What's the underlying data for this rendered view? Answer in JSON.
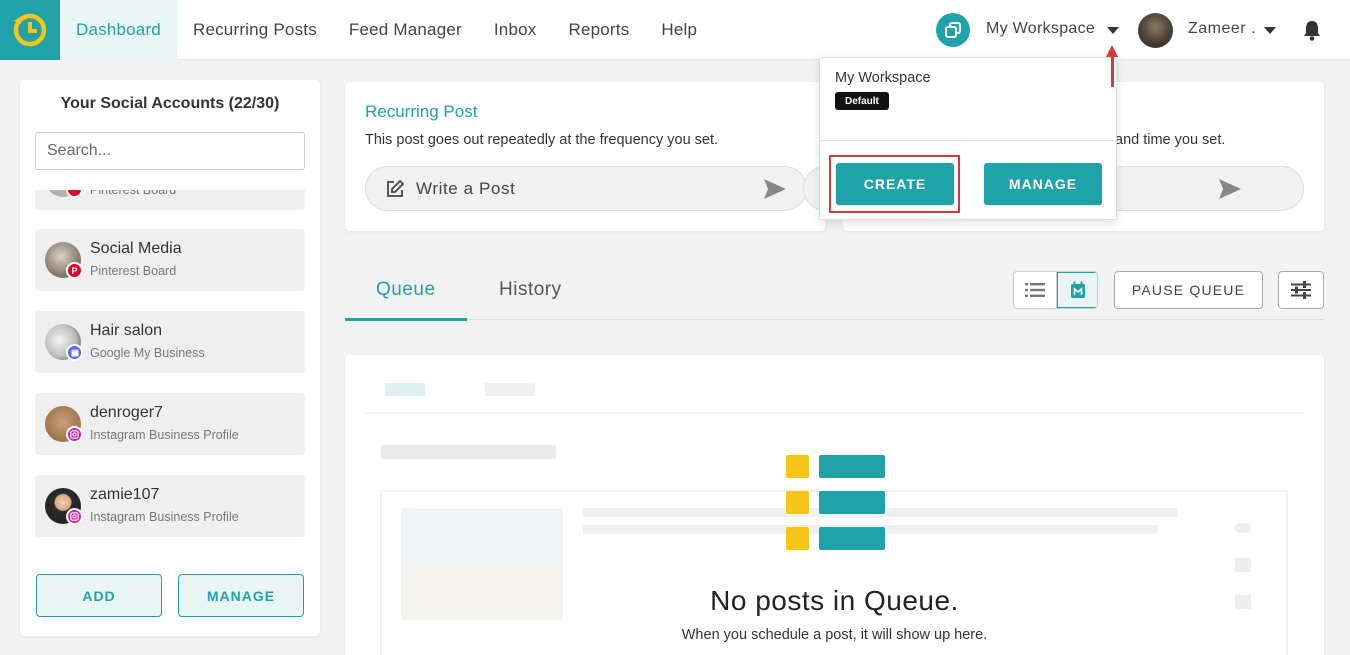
{
  "nav": {
    "items": [
      {
        "label": "Dashboard",
        "active": true
      },
      {
        "label": "Recurring Posts",
        "active": false
      },
      {
        "label": "Feed Manager",
        "active": false
      },
      {
        "label": "Inbox",
        "active": false
      },
      {
        "label": "Reports",
        "active": false
      },
      {
        "label": "Help",
        "active": false
      }
    ],
    "workspace": "My Workspace",
    "user": "Zameer ."
  },
  "accounts_panel": {
    "title": "Your Social Accounts (22/30)",
    "search_placeholder": "Search...",
    "partial_item_type": "Pinterest Board",
    "accounts": [
      {
        "name": "Social Media",
        "type": "Pinterest Board",
        "network": "pinterest"
      },
      {
        "name": "Hair salon",
        "type": "Google My Business",
        "network": "google-my-business"
      },
      {
        "name": "denroger7",
        "type": "Instagram Business Profile",
        "network": "instagram"
      },
      {
        "name": "zamie107",
        "type": "Instagram Business Profile",
        "network": "instagram"
      }
    ],
    "add_label": "ADD",
    "manage_label": "MANAGE"
  },
  "recurring_card": {
    "title": "Recurring Post",
    "description": "This post goes out repeatedly at the frequency you set.",
    "write_label": "Write a Post"
  },
  "scheduled_card": {
    "description_visible": "and time you set."
  },
  "tabs": {
    "queue": "Queue",
    "history": "History"
  },
  "pause_label": "PAUSE QUEUE",
  "queue": {
    "empty_title": "No posts in Queue.",
    "empty_subtitle": "When you schedule a post, it will show up here."
  },
  "workspace_dropdown": {
    "name": "My Workspace",
    "badge": "Default",
    "create_label": "CREATE",
    "manage_label": "MANAGE"
  },
  "colors": {
    "brand": "#20a3a8",
    "highlight": "#d9363e",
    "pinterest": "#e60023",
    "instagram": "#d6249f",
    "gmb": "#4a6cf7",
    "empty_accent": "#f5c518"
  }
}
